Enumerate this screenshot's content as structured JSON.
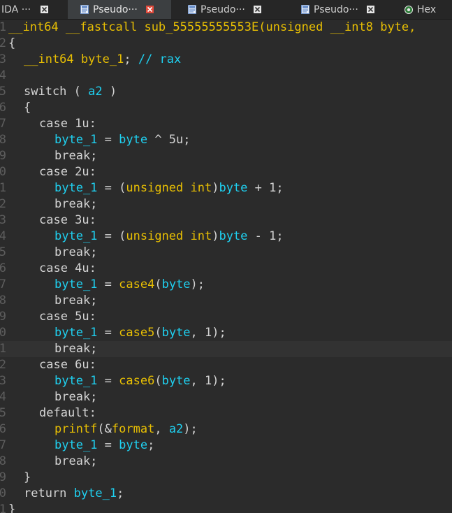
{
  "tabs": [
    {
      "label": "IDA ···",
      "active": false
    },
    {
      "label": "Pseudo···",
      "active": true
    },
    {
      "label": "Pseudo···",
      "active": false
    },
    {
      "label": "Pseudo···",
      "active": false
    },
    {
      "label": "Hex",
      "active": false
    }
  ],
  "gutter": [
    "1",
    "2",
    "3",
    "4",
    "5",
    "6",
    "7",
    "8",
    "9",
    "0",
    "1",
    "2",
    "3",
    "4",
    "5",
    "6",
    "7",
    "8",
    "9",
    "0",
    "1",
    "2",
    "3",
    "4",
    "5",
    "6",
    "7",
    "8",
    "9",
    "0",
    "1"
  ],
  "code": {
    "l1_a": "__int64 __fastcall sub_55555555553E(unsigned __int8 byte,",
    "l2": "{",
    "l3_type": "__int64",
    "l3_var": "byte_1",
    "l3_semi": ";",
    "l3_cm": "// rax",
    "l5_kw": "switch ( ",
    "l5_var": "a2",
    "l5_end": " )",
    "l6": "{",
    "case1": "case 1u:",
    "case2": "case 2u:",
    "case3": "case 3u:",
    "case4": "case 4u:",
    "case5": "case 5u:",
    "case6": "case 6u:",
    "default": "default:",
    "brk": "break;",
    "var_byte1": "byte_1",
    "var_byte": "byte",
    "eq": " = ",
    "l8_rest": " ^ 5u;",
    "cast_open": "(",
    "cast": "unsigned int",
    "cast_close": ")",
    "plus1": " + 1;",
    "minus1": " - 1;",
    "fn_case4": "case4",
    "fn_case5": "case5",
    "fn_case6": "case6",
    "paren_open": "(",
    "paren_close": ");",
    "comma1": ", 1);",
    "fn_printf": "printf",
    "printf_args_a": "(&",
    "printf_fmt": "format",
    "printf_args_b": ", ",
    "printf_a2": "a2",
    "printf_end": ");",
    "semi": ";",
    "close_switch": "}",
    "ret_kw": "return ",
    "ret_var": "byte_1",
    "ret_semi": ";",
    "close_fn": "}"
  }
}
